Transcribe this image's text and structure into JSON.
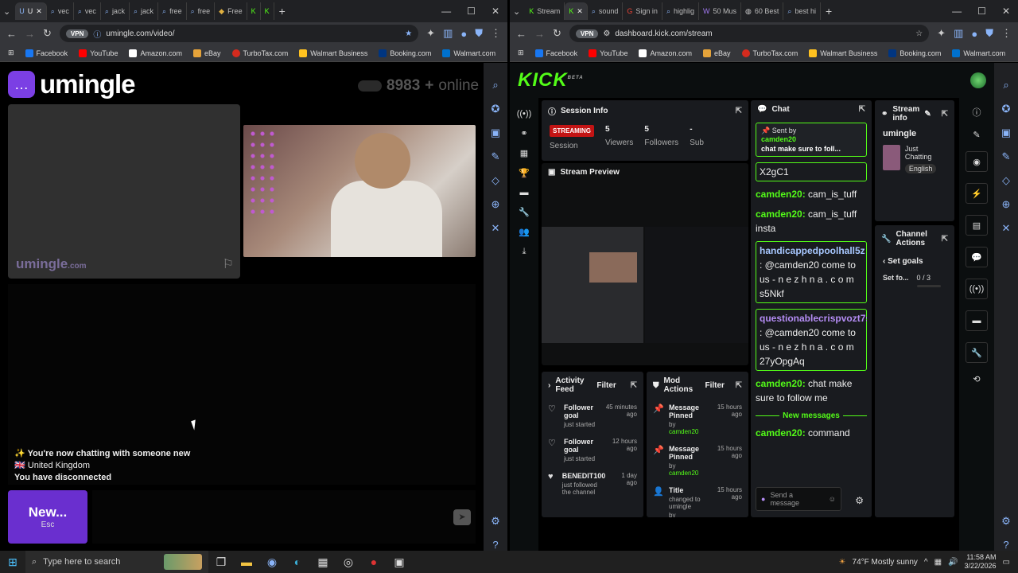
{
  "left_browser": {
    "tabs": [
      {
        "label": "U"
      },
      {
        "label": "vec"
      },
      {
        "label": "vec"
      },
      {
        "label": "jack"
      },
      {
        "label": "jack"
      },
      {
        "label": "free"
      },
      {
        "label": "free"
      },
      {
        "label": "Free"
      },
      {
        "label": ""
      },
      {
        "label": ""
      }
    ],
    "url": "umingle.com/video/",
    "vpn": "VPN",
    "bookmarks": [
      "Facebook",
      "YouTube",
      "Amazon.com",
      "eBay",
      "TurboTax.com",
      "Walmart Business",
      "Booking.com",
      "Walmart.com"
    ]
  },
  "umingle": {
    "logo": "umingle",
    "online_count": "8983",
    "online_label": "online",
    "watermark": "umingle",
    "watermark_suffix": ".com",
    "status_line1": "You're now chatting with someone new",
    "status_country": "United Kingdom",
    "status_line3": "You have disconnected",
    "new_button": "New...",
    "new_button_hint": "Esc"
  },
  "right_browser": {
    "tabs": [
      {
        "label": "Stream"
      },
      {
        "label": ""
      },
      {
        "label": "sound"
      },
      {
        "label": "Sign in"
      },
      {
        "label": "highlig"
      },
      {
        "label": "50 Mus"
      },
      {
        "label": "60 Best"
      },
      {
        "label": "best hi"
      }
    ],
    "url": "dashboard.kick.com/stream",
    "vpn": "VPN",
    "bookmarks": [
      "Facebook",
      "YouTube",
      "Amazon.com",
      "eBay",
      "TurboTax.com",
      "Walmart Business",
      "Booking.com",
      "Walmart.com"
    ]
  },
  "kick": {
    "logo": "KICK",
    "logo_sup": "BETA",
    "session_info": {
      "title": "Session Info",
      "status": "STREAMING",
      "session_label": "Session",
      "viewers_value": "5",
      "viewers_label": "Viewers",
      "followers_value": "5",
      "followers_label": "Followers",
      "sub_value": "-",
      "sub_label": "Sub"
    },
    "stream_preview_title": "Stream Preview",
    "activity_feed": {
      "title": "Activity Feed",
      "filter": "Filter",
      "items": [
        {
          "title": "Follower goal",
          "sub": "just started",
          "time": "45 minutes ago"
        },
        {
          "title": "Follower goal",
          "sub": "just started",
          "time": "12 hours ago"
        },
        {
          "title": "BENEDIT100",
          "sub": "just followed the channel",
          "time": "1 day ago"
        }
      ]
    },
    "mod_actions": {
      "title": "Mod Actions",
      "filter": "Filter",
      "items": [
        {
          "title": "Message Pinned",
          "by": "camden20",
          "time": "15 hours ago"
        },
        {
          "title": "Message Pinned",
          "by": "camden20",
          "time": "15 hours ago"
        },
        {
          "title": "Title",
          "changed": "changed to umingle",
          "by": "camden20",
          "time": "15 hours ago"
        }
      ]
    },
    "chat": {
      "title": "Chat",
      "pinned_label": "Sent by",
      "pinned_user": "camden20",
      "pinned_text": "chat make sure to foll...",
      "messages": [
        {
          "user": "",
          "text": "X2gC1"
        },
        {
          "user": "camden20:",
          "text": "cam_is_tuff"
        },
        {
          "user": "camden20:",
          "text": "cam_is_tuff insta"
        },
        {
          "user": "handicappedpoolhall5z",
          "text": ": @camden20 come to us - n e z h n a . c o m s5Nkf"
        },
        {
          "user": "questionablecrispvozt7s",
          "text": ": @camden20 come to us - n e z h n a . c o m 27yOpgAq"
        },
        {
          "user": "camden20:",
          "text": "chat make sure to follow me"
        }
      ],
      "new_messages": "New messages",
      "last_user": "camden20:",
      "last_text": "command",
      "input_placeholder": "Send a message"
    },
    "stream_info": {
      "title": "Stream info",
      "stream_title": "umingle",
      "category": "Just Chatting",
      "language": "English"
    },
    "channel_actions": {
      "title": "Channel Actions",
      "set_goals": "Set goals",
      "goal_label": "Set fo...",
      "goal_progress": "0 / 3"
    }
  },
  "taskbar": {
    "search_placeholder": "Type here to search",
    "weather": "74°F  Mostly sunny",
    "time": "11:58 AM",
    "date": "3/22/2026"
  }
}
